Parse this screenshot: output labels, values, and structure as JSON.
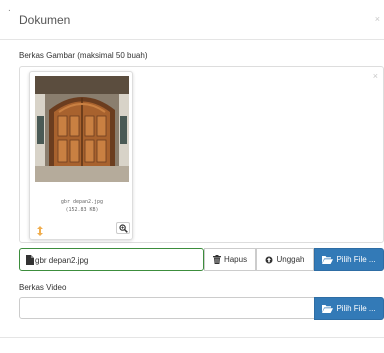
{
  "header": {
    "dot": ".",
    "title": "Dokumen",
    "close": "×"
  },
  "gambar": {
    "label": "Berkas Gambar (maksimal 50 buah)",
    "drop_close": "×",
    "preview": {
      "file_name": "gbr depan2.jpg",
      "file_size": "(152.83 KB)"
    },
    "input_value": "gbr depan2.jpg",
    "remove_label": "Hapus",
    "upload_label": "Unggah",
    "browse_label": "Pilih File ..."
  },
  "video": {
    "label": "Berkas Video",
    "input_value": "",
    "browse_label": "Pilih File ..."
  },
  "colors": {
    "primary": "#337ab7",
    "success_border": "#3c8d3c",
    "drag_handle": "#f0ad4e"
  },
  "icons": {
    "file": "file-icon",
    "trash": "trash-icon",
    "upload": "upload-icon",
    "folder": "folder-open-icon",
    "zoom": "zoom-icon",
    "drag": "drag-handle-icon"
  }
}
